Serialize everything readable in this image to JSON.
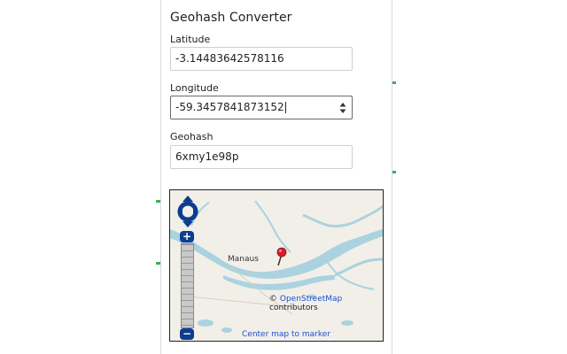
{
  "popup": {
    "title": "Geohash Converter",
    "latitude": {
      "label": "Latitude",
      "value": "-3.14483642578116"
    },
    "longitude": {
      "label": "Longitude",
      "value": "-59.3457841873152"
    },
    "geohash": {
      "label": "Geohash",
      "value": "6xmy1e98p"
    }
  },
  "map": {
    "place_label": "Manaus",
    "attribution_prefix": "©",
    "attribution_link": "OpenStreetMap",
    "attribution_suffix": "contributors",
    "center_link": "Center map to marker",
    "zoom_in_label": "+",
    "zoom_out_label": "−"
  },
  "colors": {
    "water": "#aad3df",
    "land": "#f2efe9",
    "control": "#0b3d91",
    "link": "#1a4fd1",
    "marker": "#d61f2b"
  }
}
